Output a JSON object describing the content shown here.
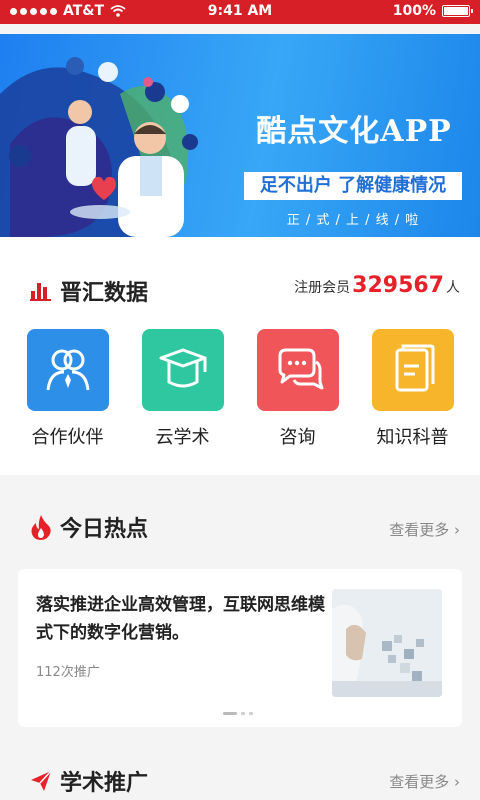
{
  "status_bar": {
    "carrier": "AT&T",
    "time": "9:41 AM",
    "battery": "100%",
    "battery_level": 1.0
  },
  "banner": {
    "title": "酷点文化APP",
    "slogan": "足不出户 了解健康情况",
    "launch_text": "正 / 式 / 上 / 线 / 啦"
  },
  "data_section": {
    "title": "晋汇数据",
    "members_prefix": "注册会员",
    "members_count": "329567",
    "members_suffix": "人",
    "items": [
      {
        "label": "合作伙伴",
        "icon": "partners-icon",
        "color": "#2e8fe8"
      },
      {
        "label": "云学术",
        "icon": "graduation-cap-icon",
        "color": "#2ec7a0"
      },
      {
        "label": "咨询",
        "icon": "chat-icon",
        "color": "#f0555a"
      },
      {
        "label": "知识科普",
        "icon": "book-icon",
        "color": "#f7b52c"
      }
    ]
  },
  "hot_section": {
    "title": "今日热点",
    "more": "查看更多 ›",
    "article": {
      "headline": "落实推进企业高效管理，互联网思维模式下的数字化营销。",
      "meta": "112次推广"
    }
  },
  "academic_section": {
    "title": "学术推广",
    "more": "查看更多 ›"
  },
  "colors": {
    "brand_red": "#d61f26",
    "accent_number": "#e8202a",
    "banner_blue": "#1e7ff0"
  }
}
